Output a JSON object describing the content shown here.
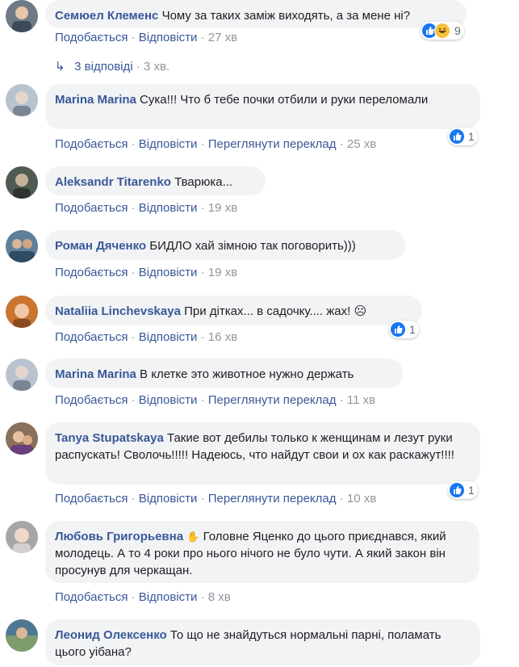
{
  "comments": [
    {
      "author": "Семюел Клеменс",
      "text": "Чому за таких заміж виходять, а за мене ні?",
      "like": "Подобається",
      "reply": "Відповісти",
      "time": "27 хв",
      "reactions": "9",
      "avatar_color": "#6f7a86"
    },
    {
      "author": "Marina Marina",
      "text": "Сука!!! Что б тебе почки отбили и руки переломали",
      "like": "Подобається",
      "reply": "Відповісти",
      "translate": "Переглянути переклад",
      "time": "25 хв",
      "reactions": "1",
      "avatar_color": "#b9c3cf"
    },
    {
      "author": "Aleksandr Titarenko",
      "text": "Тварюка...",
      "like": "Подобається",
      "reply": "Відповісти",
      "time": "19 хв",
      "avatar_color": "#4f5b52"
    },
    {
      "author": "Роман Дяченко",
      "text": "БИДЛО хай зімною так поговорить)))",
      "like": "Подобається",
      "reply": "Відповісти",
      "time": "19 хв",
      "avatar_color": "#5f7f9a"
    },
    {
      "author": "Nataliia Linchevskaya",
      "text": "При дітках... в садочку.... жах! ☹",
      "like": "Подобається",
      "reply": "Відповісти",
      "time": "16 хв",
      "reactions": "1",
      "avatar_color": "#c9752f"
    },
    {
      "author": "Marina Marina",
      "text": "В клетке это животное нужно держать",
      "like": "Подобається",
      "reply": "Відповісти",
      "translate": "Переглянути переклад",
      "time": "11 хв",
      "avatar_color": "#b9c3cf"
    },
    {
      "author": "Tanya Stupatskaya",
      "text": "Такие вот дебилы только к женщинам и лезут руки распускать! Сволочь!!!!! Надеюсь, что найдут свои и ох как раскажут!!!!",
      "like": "Подобається",
      "reply": "Відповісти",
      "translate": "Переглянути переклад",
      "time": "10 хв",
      "reactions": "1",
      "avatar_color": "#8a6f5a"
    },
    {
      "author": "Любовь Григорьевна",
      "text": "Головне Яценко до цього приєднався, який молодець. А то 4 роки про нього нічого не було чути. А який закон він просунув для черкащан.",
      "like": "Подобається",
      "reply": "Відповісти",
      "time": "8 хв",
      "avatar_color": "#a8a5a6"
    },
    {
      "author": "Леонид Олексенко",
      "text": "То що не знайдуться нормальні парні, поламать цього уібана?",
      "avatar_color": "#4f7793"
    }
  ],
  "replies_link": {
    "label": "3 відповіді",
    "time": "3 хв."
  },
  "author_badge_icon": "waving-hand-icon",
  "colors": {
    "link": "#385898",
    "bubble": "#f2f3f5",
    "meta": "#90949c",
    "like": "#1877f2"
  }
}
